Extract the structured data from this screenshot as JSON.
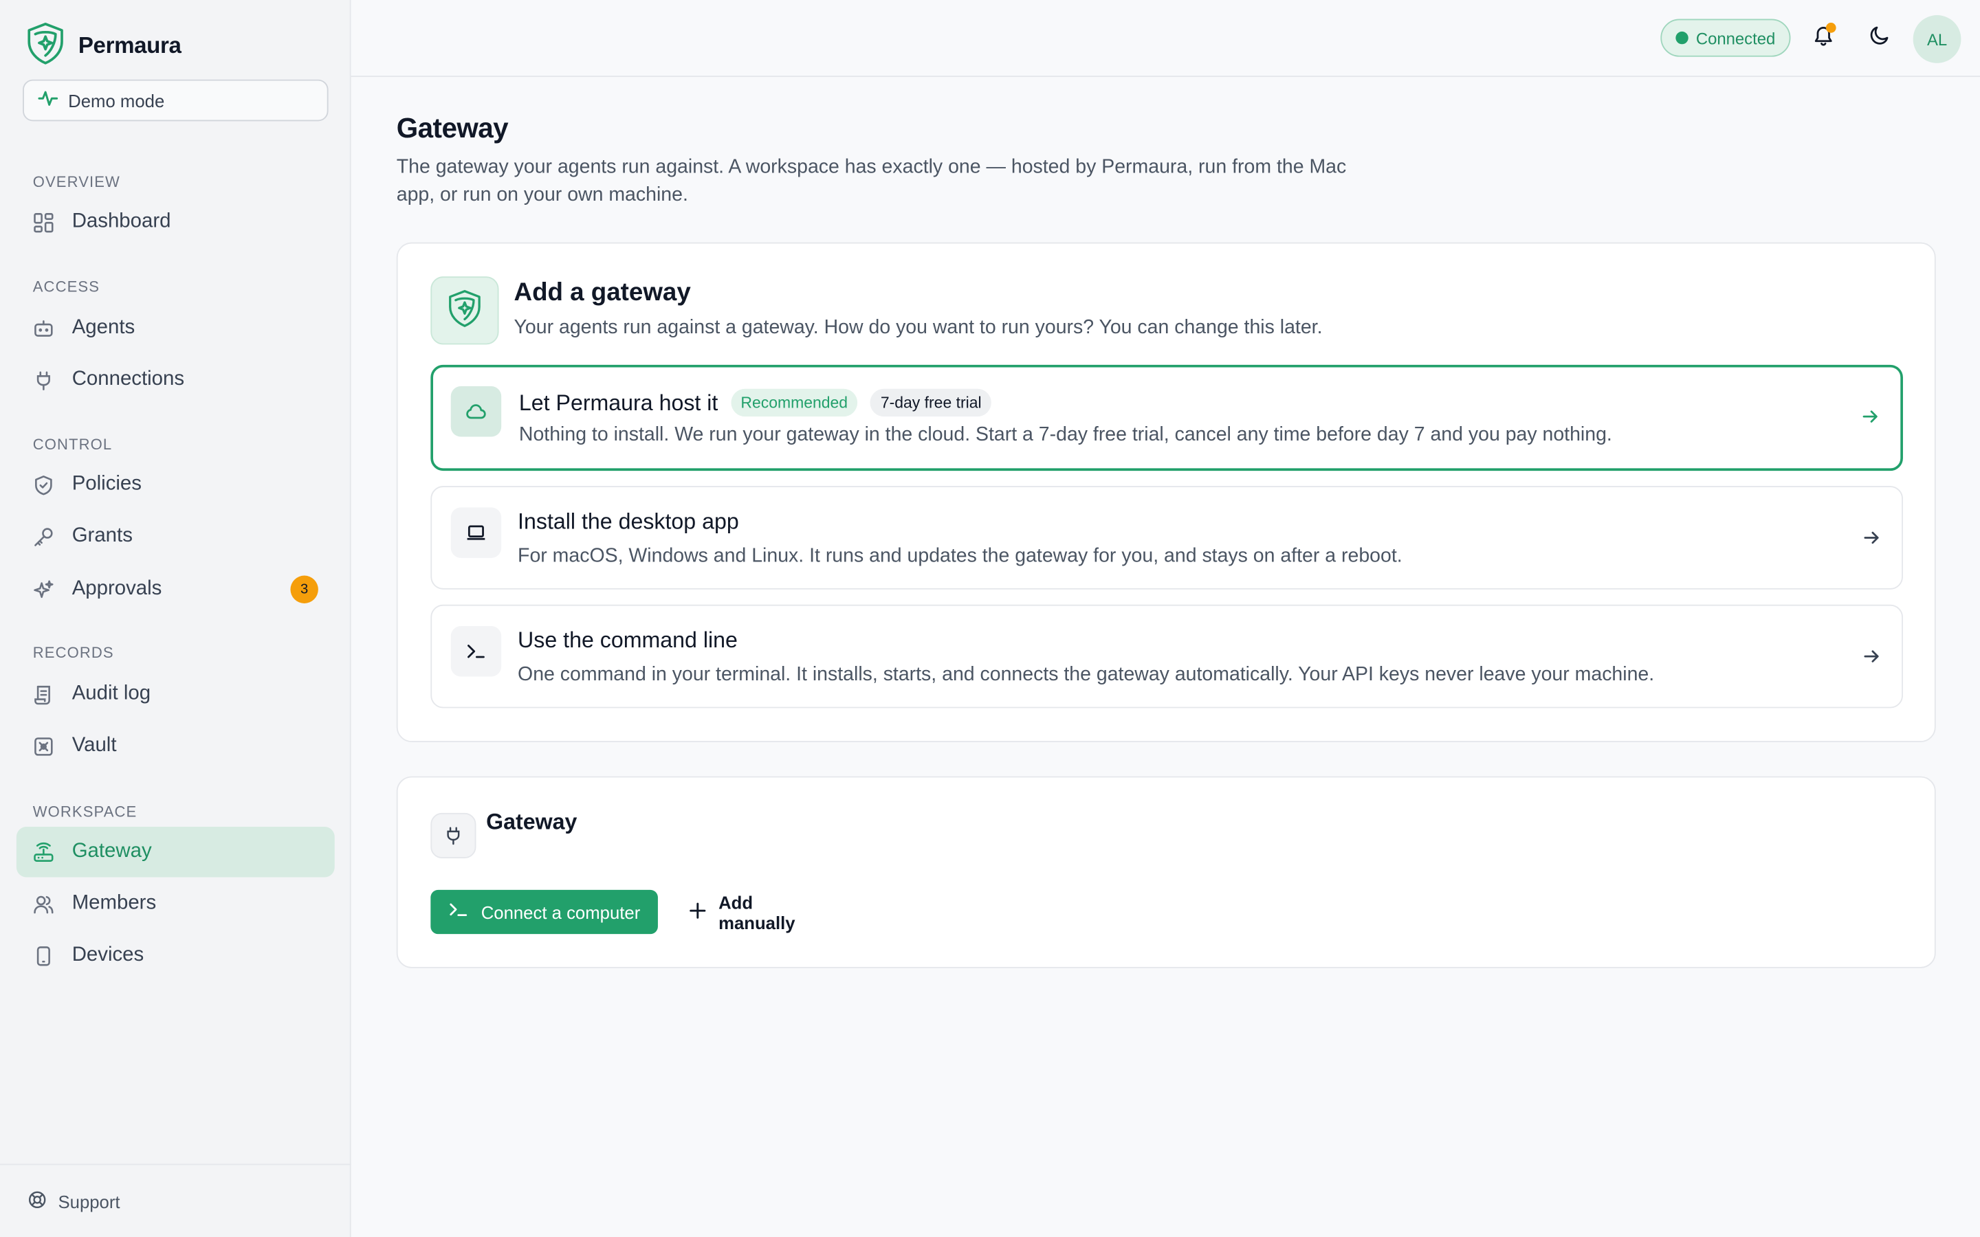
{
  "brand": {
    "name": "Permaura",
    "icon": "permaura-logo"
  },
  "sidebar": {
    "demo_label": "Demo mode",
    "sections": {
      "overview": "Overview",
      "access": "Access",
      "control": "Control",
      "records": "Records",
      "workspace": "Workspace"
    },
    "items": {
      "dashboard": "Dashboard",
      "agents": "Agents",
      "connections": "Connections",
      "policies": "Policies",
      "grants": "Grants",
      "approvals": "Approvals",
      "approvals_count": "3",
      "audit_log": "Audit log",
      "vault": "Vault",
      "gateway": "Gateway",
      "members": "Members",
      "devices": "Devices"
    },
    "support": "Support"
  },
  "topbar": {
    "status": "Connected",
    "avatar_initials": "AL"
  },
  "page": {
    "title": "Gateway",
    "description": "The gateway your agents run against. A workspace has exactly one — hosted by Permaura, run from the Mac app, or run on your own machine."
  },
  "add_gateway": {
    "title": "Add a gateway",
    "subtitle": "Your agents run against a gateway. How do you want to run yours? You can change this later.",
    "options": [
      {
        "title": "Let Permaura host it",
        "badges": [
          "Recommended",
          "7-day free trial"
        ],
        "description": "Nothing to install. We run your gateway in the cloud. Start a 7-day free trial, cancel any time before day 7 and you pay nothing."
      },
      {
        "title": "Install the desktop app",
        "description": "For macOS, Windows and Linux. It runs and updates the gateway for you, and stays on after a reboot."
      },
      {
        "title": "Use the command line",
        "description": "One command in your terminal. It installs, starts, and connects the gateway automatically. Your API keys never leave your machine."
      }
    ]
  },
  "gateway_card": {
    "title": "Gateway",
    "connect_label": "Connect a computer",
    "add_manual_label": "Add manually"
  },
  "colors": {
    "accent": "#22a06b",
    "accent_soft": "#d7ebe2",
    "warning": "#f59e0b"
  }
}
